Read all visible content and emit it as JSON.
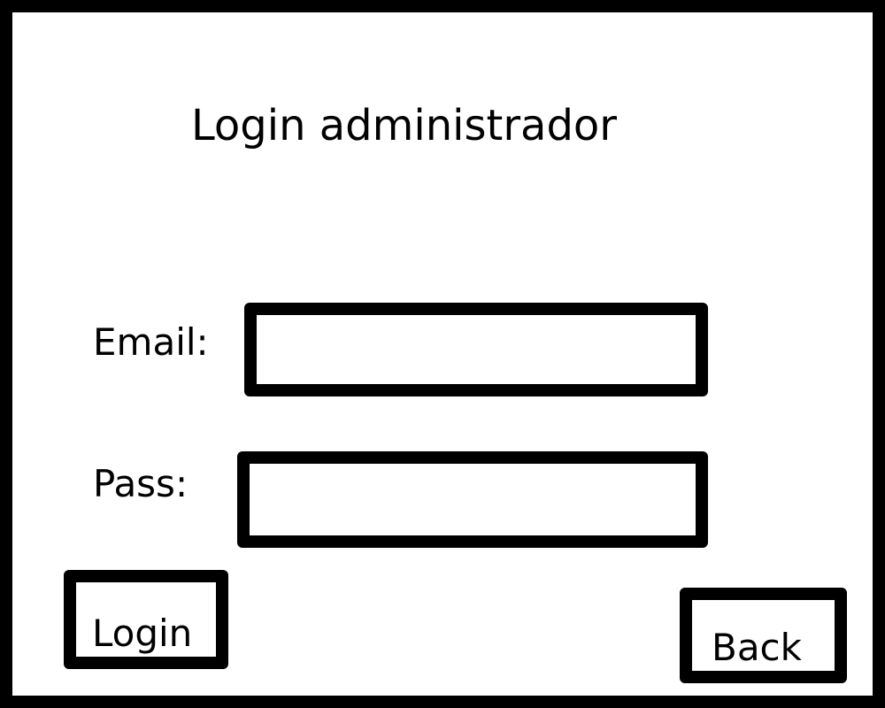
{
  "window": {
    "title": "Login administrador"
  },
  "form": {
    "email": {
      "label": "Email:",
      "value": "",
      "placeholder": ""
    },
    "password": {
      "label": "Pass:",
      "value": "",
      "placeholder": ""
    }
  },
  "actions": {
    "login_label": "Login",
    "back_label": "Back"
  },
  "colors": {
    "border": "#000000",
    "background": "#ffffff",
    "text": "#000000"
  }
}
